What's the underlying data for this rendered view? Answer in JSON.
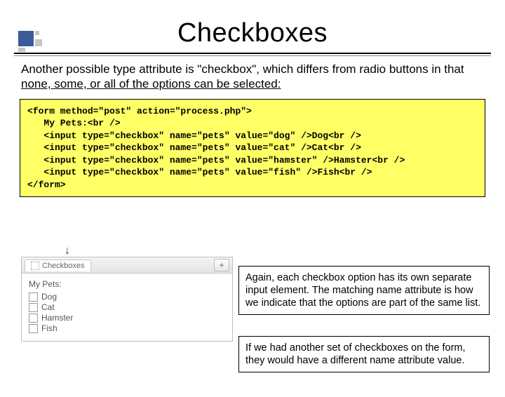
{
  "title": "Checkboxes",
  "intro_a": "Another possible type attribute is \"checkbox\", which differs from radio buttons in that ",
  "intro_u": "none, some, or all of the options can be selected:",
  "code": "<form method=\"post\" action=\"process.php\">\n   My Pets:<br />\n   <input type=\"checkbox\" name=\"pets\" value=\"dog\" />Dog<br />\n   <input type=\"checkbox\" name=\"pets\" value=\"cat\" />Cat<br />\n   <input type=\"checkbox\" name=\"pets\" value=\"hamster\" />Hamster<br />\n   <input type=\"checkbox\" name=\"pets\" value=\"fish\" />Fish<br />\n</form>",
  "mock": {
    "tab": "Checkboxes",
    "heading": "My Pets:",
    "items": [
      "Dog",
      "Cat",
      "Hamster",
      "Fish"
    ]
  },
  "callout1": "Again, each checkbox option has its own separate input element.  The matching name attribute is how we indicate that the options are part of the same list.",
  "callout2": "If we had another set of checkboxes on the form, they would have a different name attribute value."
}
